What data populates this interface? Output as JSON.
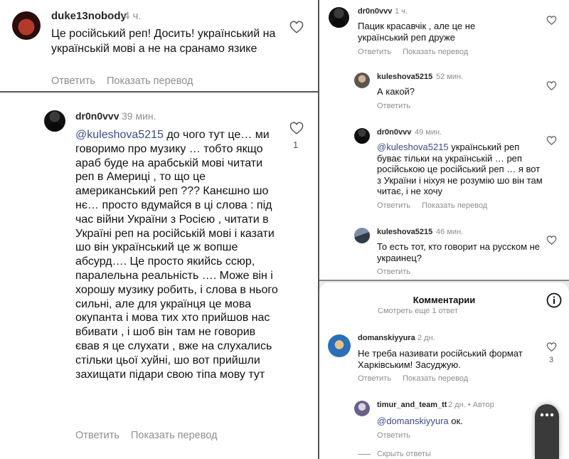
{
  "left": {
    "comment1": {
      "username": "duke13nobody",
      "time": "4 ч.",
      "text": "Це російський реп! Досить! український на українській мові а не на сранамо язике",
      "reply": "Ответить",
      "translate": "Показать перевод"
    },
    "comment2": {
      "username": "dr0n0vvv",
      "time": "39 мин.",
      "mention": "@kuleshova5215",
      "text": " до чого тут це… ми говоримо про музику … тобто якщо араб буде на арабській мові читати реп в Америці , то що це американський реп ??? Канєшно шо нє…  просто вдумайся в ці слова : під час війни України з Росією , читати в Україні реп на російській мові і казати шо він український це ж вопше абсурд…. Це просто якийсь ссюр, паралельна реальність …. Може він і хорошу музику робить, і слова в нього сильні, але для українця це мова окупанта і мова тих хто прийшов нас вбивати , і шоб він там не говорив євав я це слухати , вже на слухались стільки цьої хуйні, шо вот прийшли захищати підари свою тіпа мову тут",
      "likes": "1",
      "reply": "Ответить",
      "translate": "Показать перевод"
    }
  },
  "right_top": {
    "comment1": {
      "username": "dr0n0vvv",
      "time": "1 ч.",
      "text": "Пацик красавчік , але це не український реп друже",
      "reply": "Ответить",
      "translate": "Показать перевод"
    },
    "comment2": {
      "username": "kuleshova5215",
      "time": "52 мин.",
      "text": "А какой?",
      "reply": "Ответить"
    },
    "comment3": {
      "username": "dr0n0vvv",
      "time": "49 мин.",
      "mention": "@kuleshova5215",
      "text": " український реп буває тільки на українській … реп російською це російський реп … я вот з України і ніхуя не розумію шо він там читає, і не хочу",
      "reply": "Ответить",
      "translate": "Показать перевод"
    },
    "comment4": {
      "username": "kuleshova5215",
      "time": "46 мин.",
      "text": "То есть тот, кто говорит на русском не украинец?",
      "reply": "Ответить"
    }
  },
  "right_bottom": {
    "header_title": "Комментарии",
    "info_icon": "info-icon",
    "see_more": "Смотреть еще 1 ответ",
    "comment1": {
      "username": "domanskiyyura",
      "time": "2 дн.",
      "text": "Не треба називати російський формат Харківським! Засуджую.",
      "likes": "3",
      "reply": "Ответить",
      "translate": "Показать перевод"
    },
    "comment2": {
      "username": "timur_and_team_tt",
      "time": "2 дн. • Автор",
      "mention": "@domanskiyyura",
      "text": " ок.",
      "reply": "Ответить"
    },
    "hide_replies": "Скрыть ответы"
  }
}
